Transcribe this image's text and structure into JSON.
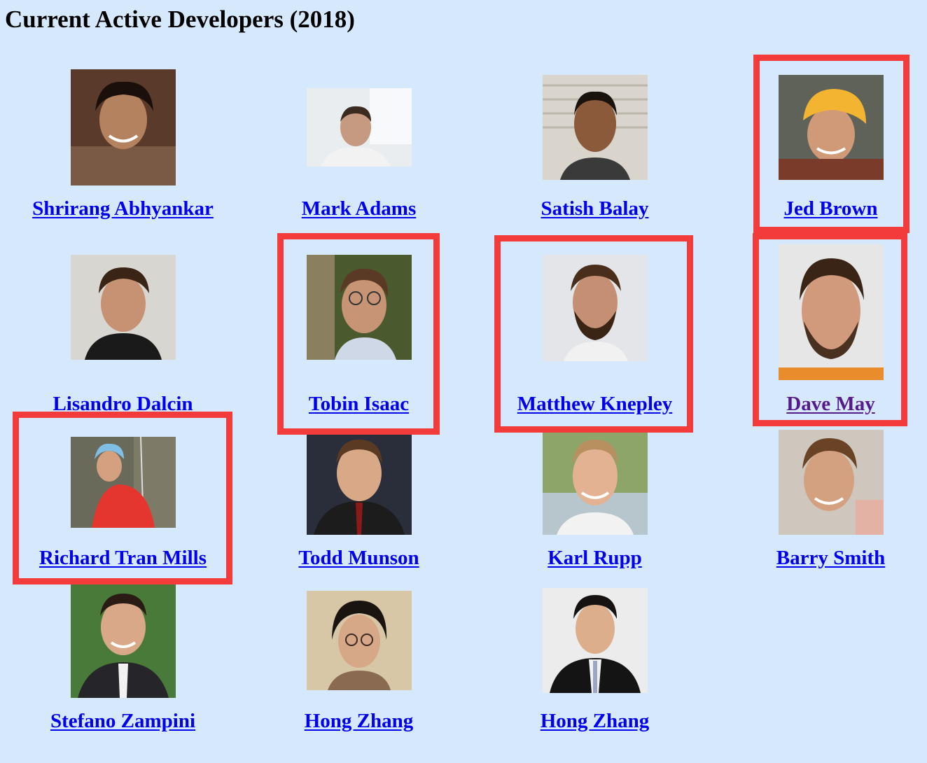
{
  "page": {
    "title": "Current Active Developers (2018)"
  },
  "colors": {
    "background": "#d6e8fb",
    "link": "#0000ee",
    "visited_link": "#551a8b",
    "highlight": "#f43b3b"
  },
  "developers": [
    {
      "name": "Shrirang Abhyankar",
      "visited": false,
      "highlighted": false
    },
    {
      "name": "Mark Adams",
      "visited": false,
      "highlighted": false
    },
    {
      "name": "Satish Balay",
      "visited": false,
      "highlighted": false
    },
    {
      "name": "Jed Brown",
      "visited": false,
      "highlighted": true
    },
    {
      "name": "Lisandro Dalcin",
      "visited": false,
      "highlighted": false
    },
    {
      "name": "Tobin Isaac",
      "visited": false,
      "highlighted": true
    },
    {
      "name": "Matthew Knepley",
      "visited": false,
      "highlighted": true
    },
    {
      "name": "Dave May",
      "visited": true,
      "highlighted": true
    },
    {
      "name": "Richard Tran Mills",
      "visited": false,
      "highlighted": true
    },
    {
      "name": "Todd Munson",
      "visited": false,
      "highlighted": false
    },
    {
      "name": "Karl Rupp",
      "visited": false,
      "highlighted": false
    },
    {
      "name": "Barry Smith",
      "visited": false,
      "highlighted": false
    },
    {
      "name": "Stefano Zampini",
      "visited": false,
      "highlighted": false
    },
    {
      "name": "Hong Zhang",
      "visited": false,
      "highlighted": false
    },
    {
      "name": "Hong Zhang",
      "visited": false,
      "highlighted": false
    }
  ]
}
